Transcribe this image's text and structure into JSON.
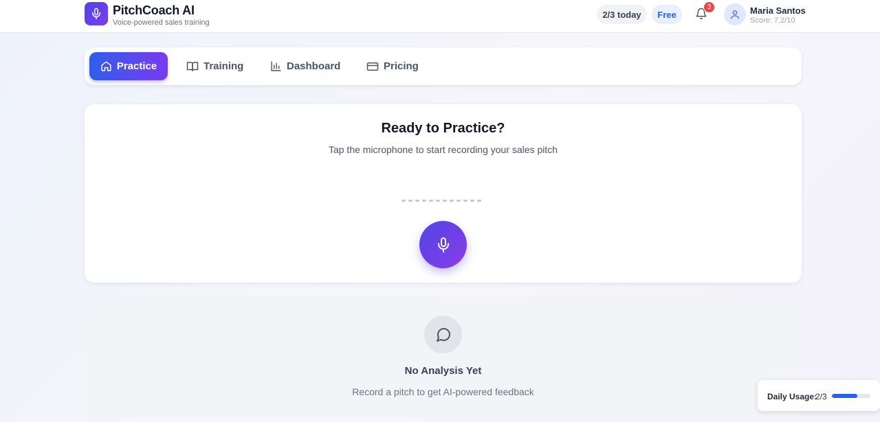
{
  "header": {
    "brand_title": "PitchCoach AI",
    "brand_subtitle": "Voice-powered sales training",
    "today_count": "2/3 today",
    "plan": "Free",
    "notification_count": "3",
    "user_name": "Maria Santos",
    "user_score": "Score: 7.2/10"
  },
  "nav": {
    "items": [
      {
        "label": "Practice",
        "icon": "home-icon",
        "active": true
      },
      {
        "label": "Training",
        "icon": "book-icon",
        "active": false
      },
      {
        "label": "Dashboard",
        "icon": "bar-chart-icon",
        "active": false
      },
      {
        "label": "Pricing",
        "icon": "credit-card-icon",
        "active": false
      }
    ]
  },
  "practice": {
    "title": "Ready to Practice?",
    "subtitle": "Tap the microphone to start recording your sales pitch",
    "mic_icon": "microphone-icon"
  },
  "analysis": {
    "icon": "message-circle-icon",
    "title": "No Analysis Yet",
    "subtitle": "Record a pitch to get AI-powered feedback"
  },
  "usage": {
    "label": "Daily Usage:",
    "value": "2/3",
    "progress": 0.667
  },
  "colors": {
    "accent_start": "#2f5fe9",
    "accent_end": "#7a3af0",
    "badge_red": "#ef4444",
    "progress_blue": "#2563eb"
  }
}
